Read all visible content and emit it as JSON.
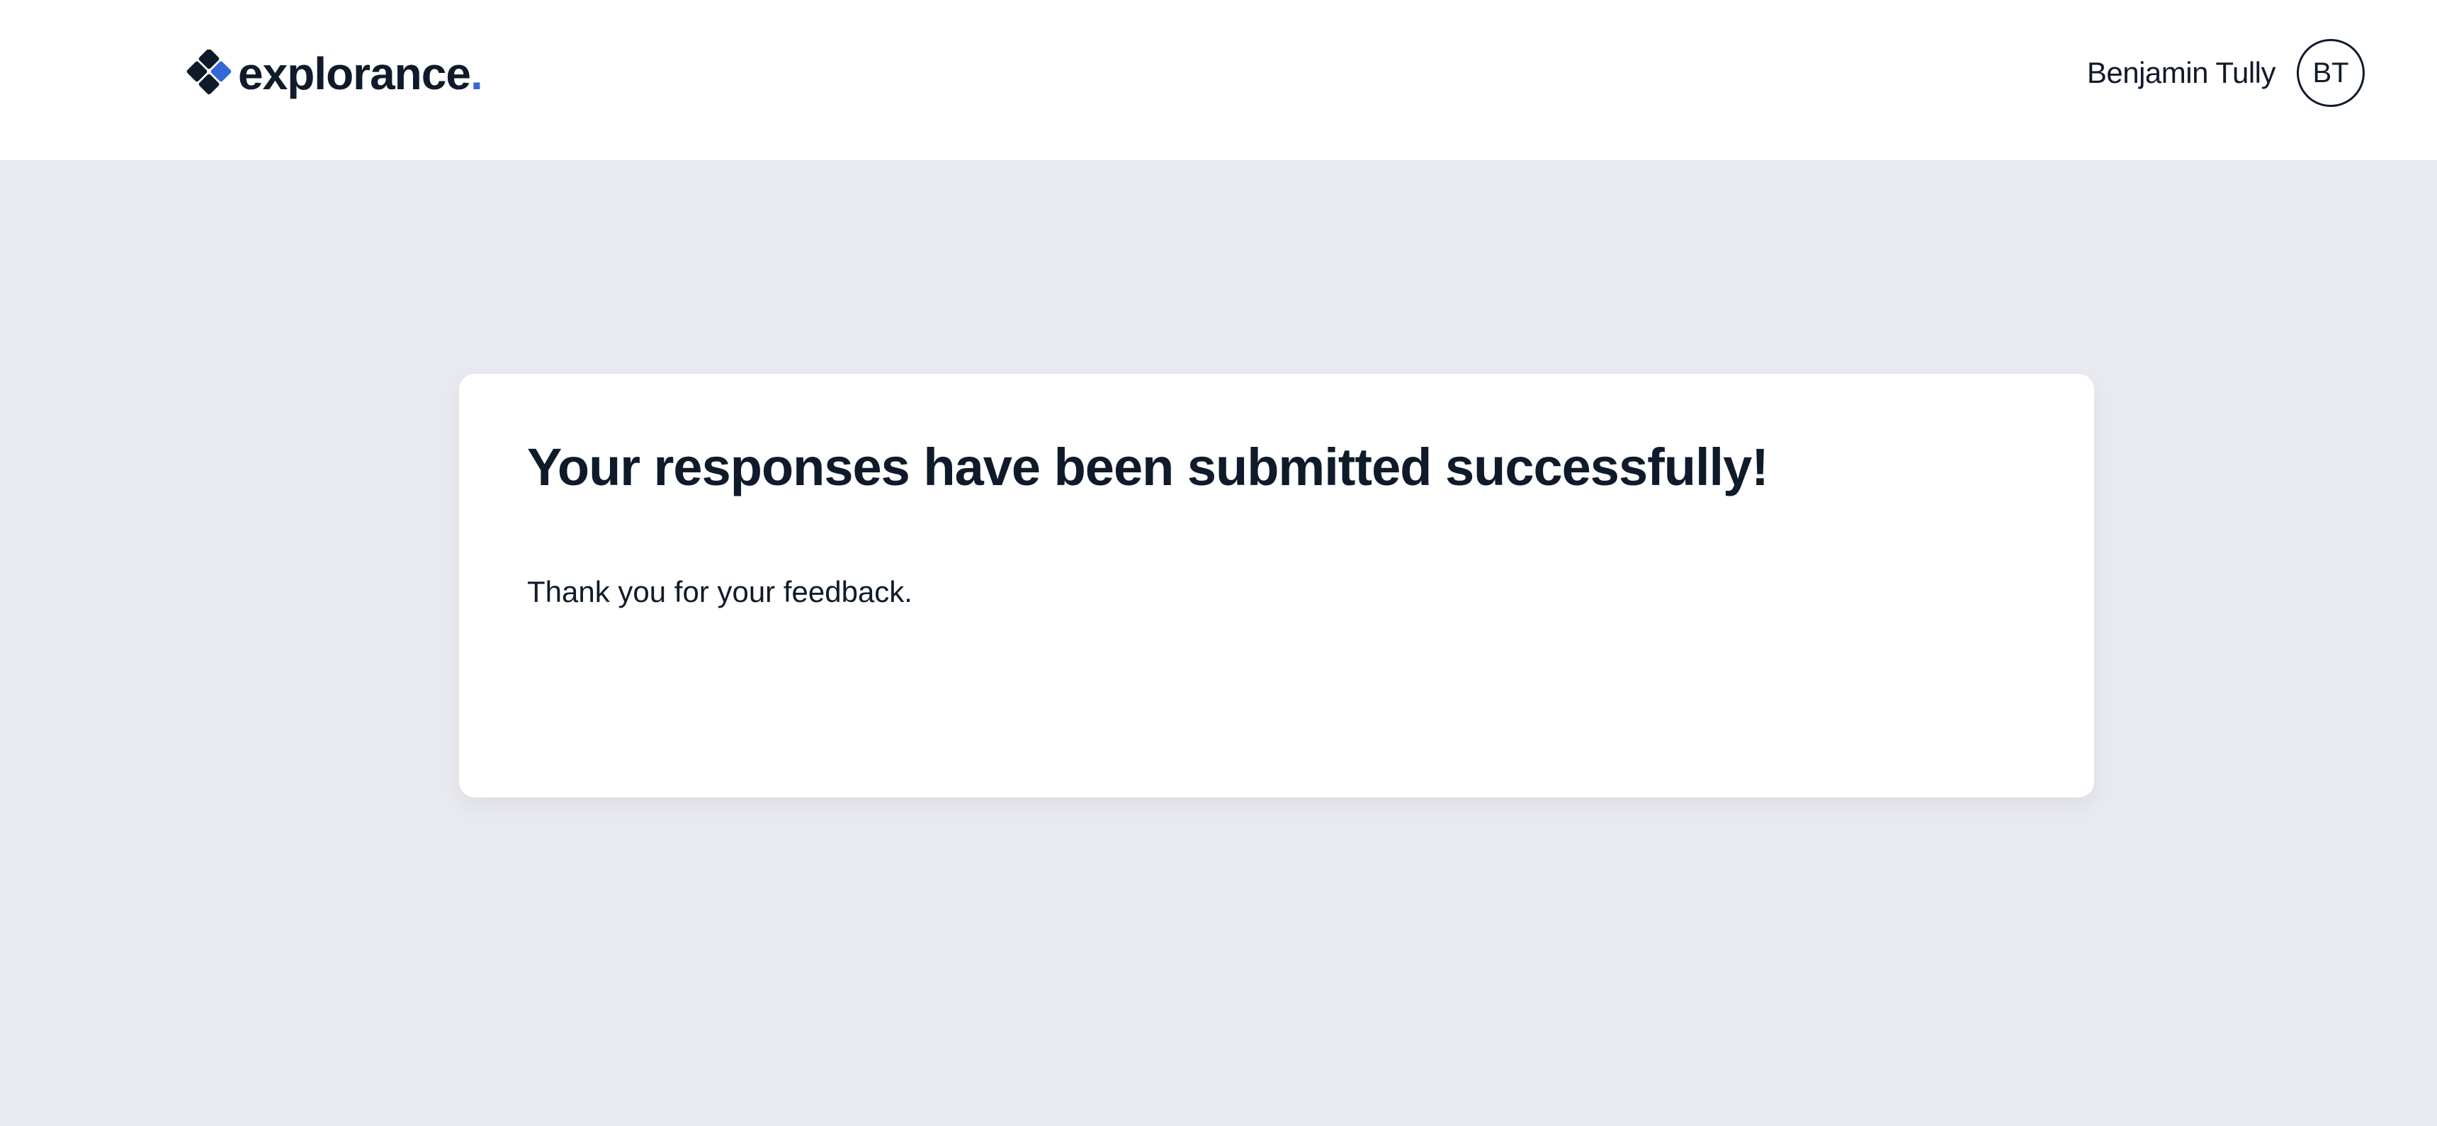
{
  "header": {
    "logo": {
      "text": "explorance",
      "dot": ".",
      "icon": "explorance-diamond-logo-icon",
      "brand_color": "#0f1b2a",
      "accent_color": "#3567d6"
    },
    "user": {
      "name": "Benjamin Tully",
      "initials": "BT"
    }
  },
  "main": {
    "title": "Your responses have been submitted successfully!",
    "message": "Thank you for your feedback."
  },
  "colors": {
    "page_background": "#e9eaef",
    "surface": "#ffffff",
    "text": "#0f1b2a"
  }
}
